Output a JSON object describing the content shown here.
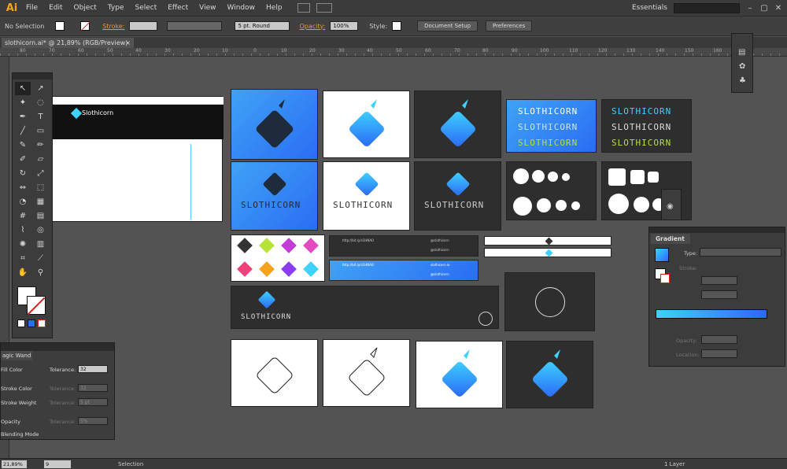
{
  "app": {
    "logo": "Ai",
    "menus": [
      "File",
      "Edit",
      "Object",
      "Type",
      "Select",
      "Effect",
      "View",
      "Window",
      "Help"
    ],
    "workspace": "Essentials",
    "window_controls": [
      "–",
      "▢",
      "✕"
    ]
  },
  "control_bar": {
    "selection": "No Selection",
    "stroke_label": "Stroke:",
    "brush": "5 pt. Round",
    "opacity_label": "Opacity:",
    "opacity_value": "100%",
    "style_label": "Style:",
    "document_setup": "Document Setup",
    "preferences": "Preferences"
  },
  "document": {
    "tab_title": "slothicorn.ai* @ 21,89% (RGB/Preview)",
    "tab_close": "×"
  },
  "ruler_ticks": [
    "80",
    "70",
    "60",
    "50",
    "40",
    "30",
    "20",
    "10",
    "0",
    "10",
    "20",
    "30",
    "40",
    "50",
    "60",
    "70",
    "80",
    "90",
    "100",
    "110",
    "120",
    "130",
    "140",
    "150",
    "160",
    "170"
  ],
  "artboards": {
    "wordmark": "SLOTHICORN",
    "wordmark_alt": "SLOTHICORN",
    "social_handles": [
      "@slothicorn",
      "@slothicorn",
      "slothicorn.io",
      "@slothicorn"
    ],
    "web_url": "http://bit.ly/s1HNAO",
    "mock_title": "Slothicorn"
  },
  "magic_wand": {
    "title": "agic Wand",
    "rows": [
      {
        "label": "Fill Color",
        "tolerance_label": "Tolerance:",
        "value": "32"
      },
      {
        "label": "Stroke Color",
        "tolerance_label": "Tolerance:",
        "value": "32"
      },
      {
        "label": "Stroke Weight",
        "tolerance_label": "Tolerance:",
        "value": "5 pt"
      },
      {
        "label": "Opacity",
        "tolerance_label": "Tolerance:",
        "value": "5%"
      },
      {
        "label": "Blending Mode",
        "tolerance_label": "",
        "value": ""
      }
    ]
  },
  "gradient_panel": {
    "title": "Gradient",
    "type_label": "Type:",
    "stroke_label": "Stroke:",
    "opacity_label": "Opacity:",
    "location_label": "Location:"
  },
  "status_bar": {
    "zoom": "21,89%",
    "page": "9",
    "tool": "Selection",
    "layers": "1 Layer"
  },
  "colors": {
    "accent_orange": "#f7a21b",
    "brand_blue": "#2a6df4",
    "brand_cyan": "#3fd1ff",
    "brand_green": "#b6e23a"
  }
}
